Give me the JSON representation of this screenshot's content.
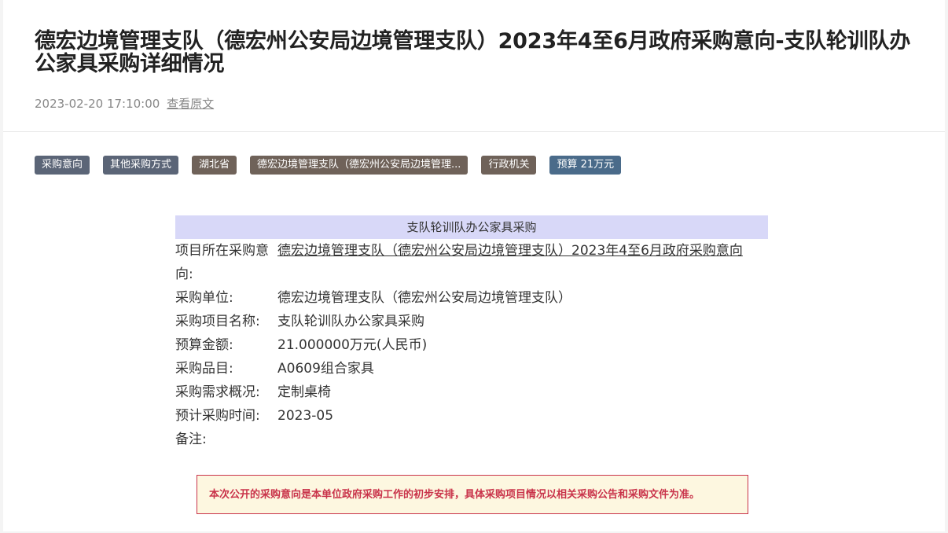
{
  "article": {
    "title": "德宏边境管理支队（德宏州公安局边境管理支队）2023年4至6月政府采购意向-支队轮训队办公家具采购详细情况",
    "datetime": "2023-02-20 17:10:00",
    "view_original": "查看原文"
  },
  "tags": [
    {
      "label": "采购意向",
      "color": "#5b6577"
    },
    {
      "label": "其他采购方式",
      "color": "#5b6577"
    },
    {
      "label": "湖北省",
      "color": "#6f6259"
    },
    {
      "label": "德宏边境管理支队（德宏州公安局边境管理...",
      "color": "#6f6259"
    },
    {
      "label": "行政机关",
      "color": "#6f6259"
    },
    {
      "label": "预算 21万元",
      "color": "#4a6b8a"
    }
  ],
  "detail": {
    "section_title": "支队轮训队办公家具采购",
    "rows": [
      {
        "label": "项目所在采购意向:",
        "value": "德宏边境管理支队（德宏州公安局边境管理支队）2023年4至6月政府采购意向"
      },
      {
        "label": "采购单位:",
        "value": "德宏边境管理支队（德宏州公安局边境管理支队）"
      },
      {
        "label": "采购项目名称:",
        "value": "支队轮训队办公家具采购"
      },
      {
        "label": "预算金额:",
        "value": "21.000000万元(人民币)"
      },
      {
        "label": "采购品目:",
        "value": "A0609组合家具"
      },
      {
        "label": "采购需求概况:",
        "value": "定制桌椅"
      },
      {
        "label": "预计采购时间:",
        "value": "2023-05"
      },
      {
        "label": "备注:",
        "value": ""
      }
    ]
  },
  "notice": "本次公开的采购意向是本单位政府采购工作的初步安排，具体采购项目情况以相关采购公告和采购文件为准。"
}
